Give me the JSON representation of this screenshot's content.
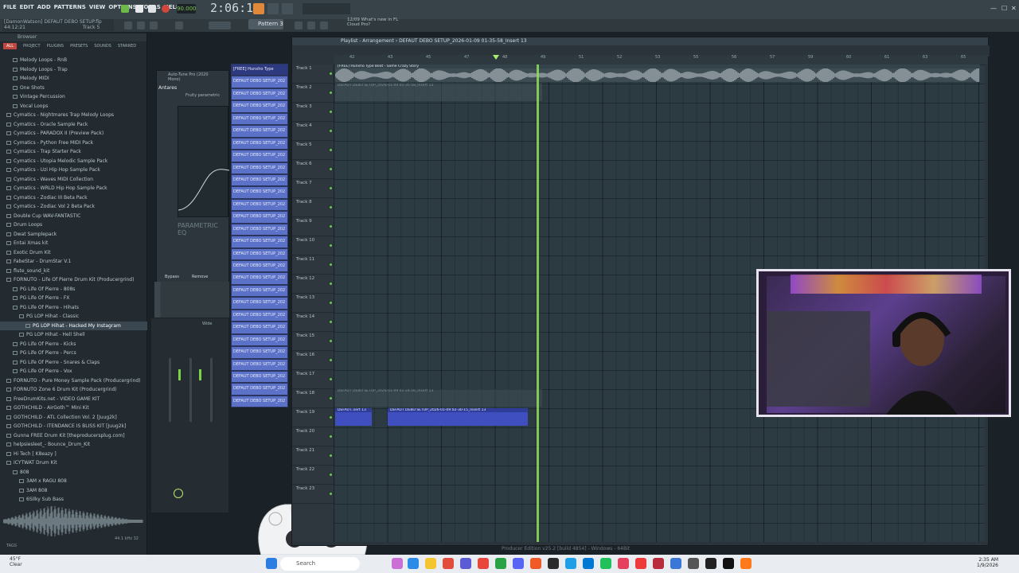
{
  "menu": [
    "FILE",
    "EDIT",
    "ADD",
    "PATTERNS",
    "VIEW",
    "OPTIONS",
    "TOOLS",
    "HELP"
  ],
  "project": {
    "user": "[DamonWatson]",
    "name": "DEFAUT DEBO SETUP.flp",
    "time": "44:12:21",
    "track": "Track 5"
  },
  "tempo": "90.000",
  "time_display": "2:06:16",
  "pattern": "Pattern 3",
  "news": {
    "line1": "12/09  What's new in FL",
    "line2": "Cloud Pro?"
  },
  "browser": {
    "title": "Browser",
    "tabs": [
      "ALL",
      "PROJECT",
      "PLUGINS",
      "PRESETS",
      "SOUNDS",
      "STARRED"
    ],
    "items": [
      {
        "label": "Melody Loops - RnB",
        "sel": false
      },
      {
        "label": "Melody Loops - Trap",
        "sel": false
      },
      {
        "label": "Melody MIDI",
        "sel": false
      },
      {
        "label": "One Shots",
        "sel": false
      },
      {
        "label": "Vintage Percussion",
        "sel": false
      },
      {
        "label": "Vocal Loops",
        "sel": false
      },
      {
        "label": "Cymatics - Nightmares Trap Melody Loops",
        "sel": false
      },
      {
        "label": "Cymatics - Oracle Sample Pack",
        "sel": false
      },
      {
        "label": "Cymatics - PARADOX II (Preview Pack)",
        "sel": false
      },
      {
        "label": "Cymatics - Python Free MIDI Pack",
        "sel": false
      },
      {
        "label": "Cymatics - Trap Starter Pack",
        "sel": false
      },
      {
        "label": "Cymatics - Utopia Melodic Sample Pack",
        "sel": false
      },
      {
        "label": "Cymatics - Uzi Hip Hop Sample Pack",
        "sel": false
      },
      {
        "label": "Cymatics - Waves MIDI Collection",
        "sel": false
      },
      {
        "label": "Cymatics - WRLD Hip Hop Sample Pack",
        "sel": false
      },
      {
        "label": "Cymatics - Zodiac III Beta Pack",
        "sel": false
      },
      {
        "label": "Cymatics - Zodiac Vol 2 Beta Pack",
        "sel": false
      },
      {
        "label": "Double Cup WAV-FANTASTIC",
        "sel": false
      },
      {
        "label": "Drum Loops",
        "sel": false
      },
      {
        "label": "Dwat Samplepack",
        "sel": false
      },
      {
        "label": "Entai Xmas kit",
        "sel": false
      },
      {
        "label": "Exotic Drum Kit",
        "sel": false
      },
      {
        "label": "FabeStar - DrumStar V.1",
        "sel": false
      },
      {
        "label": "flute_sound_kit",
        "sel": false
      },
      {
        "label": "FORNUTO - Life Of Pierre Drum Kit (Producergrind)",
        "sel": false
      },
      {
        "label": "PG Life Of Pierre - 808s",
        "sel": false
      },
      {
        "label": "PG Life Of Pierre - FX",
        "sel": false
      },
      {
        "label": "PG Life Of Pierre - Hihats",
        "sel": false
      },
      {
        "label": "PG LOP Hihat - Classic",
        "sel": false
      },
      {
        "label": "PG LOP Hihat - Hacked My Instagram",
        "sel": true
      },
      {
        "label": "PG LOP Hihat - Hell Shell",
        "sel": false
      },
      {
        "label": "PG Life Of Pierre - Kicks",
        "sel": false
      },
      {
        "label": "PG Life Of Pierre - Percs",
        "sel": false
      },
      {
        "label": "PG Life Of Pierre - Snares & Claps",
        "sel": false
      },
      {
        "label": "PG Life Of Pierre - Vox",
        "sel": false
      },
      {
        "label": "FORNUTO - Pure Money Sample Pack (Producergrind)",
        "sel": false
      },
      {
        "label": "FORNUTO Zone 6 Drum Kit (Producergrind)",
        "sel": false
      },
      {
        "label": "FreeDrumKits.net - VIDEO GAME KIT",
        "sel": false
      },
      {
        "label": "GOTHCHILD - AirGoth™ Mini Kit",
        "sel": false
      },
      {
        "label": "GOTHCHILD - ATL Collection Vol. 2 [Juug2k]",
        "sel": false
      },
      {
        "label": "GOTHCHILD - ITENDANCE IS BLISS KIT [Juug2k]",
        "sel": false
      },
      {
        "label": "Gunna FREE Drum Kit [theproducersplug.com]",
        "sel": false
      },
      {
        "label": "helpsiesleet_- Bounce_Drum_Kit",
        "sel": false
      },
      {
        "label": "Hi Tech [ K8eazy ]",
        "sel": false
      },
      {
        "label": "ICYTWAT Drum Kit",
        "sel": false
      },
      {
        "label": "808",
        "sel": false
      },
      {
        "label": "3AM x RAGU 808",
        "sel": false
      },
      {
        "label": "3AM 808",
        "sel": false
      },
      {
        "label": "6Silky Sub Bass",
        "sel": false
      }
    ],
    "tags_label": "TAGS",
    "preview_info": "44.1 kHz 32"
  },
  "plugin": {
    "title": "Auto-Tune Pro (2020 Mono)",
    "brand": "Antares",
    "sub": "Fruity parametric",
    "eq_label": "PARAMETRIC EQ",
    "remove_label": "Remove",
    "bypass_label": "Bypass",
    "mixer_label": "Wide"
  },
  "channels": [
    "[FREE] Hunxho Type",
    "DEFAUT DEBO SETUP_202",
    "DEFAUT DEBO SETUP_202",
    "DEFAUT DEBO SETUP_202",
    "DEFAUT DEBO SETUP_202",
    "DEFAUT DEBO SETUP_202",
    "DEFAUT DEBO SETUP_202",
    "DEFAUT DEBO SETUP_202",
    "DEFAUT DEBO SETUP_202",
    "DEFAUT DEBO SETUP_202",
    "DEFAUT DEBO SETUP_202",
    "DEFAUT DEBO SETUP_202",
    "DEFAUT DEBO SETUP_202",
    "DEFAUT DEBO SETUP_202",
    "DEFAUT DEBO SETUP_202",
    "DEFAUT DEBO SETUP_202",
    "DEFAUT DEBO SETUP_202",
    "DEFAUT DEBO SETUP_202",
    "DEFAUT DEBO SETUP_202",
    "DEFAUT DEBO SETUP_202",
    "DEFAUT DEBO SETUP_202",
    "DEFAUT DEBO SETUP_202",
    "DEFAUT DEBO SETUP_202",
    "DEFAUT DEBO SETUP_202",
    "DEFAUT DEBO SETUP_202",
    "DEFAUT DEBO SETUP_202",
    "DEFAUT DEBO SETUP_202",
    "DEFAUT DEBO SETUP_202"
  ],
  "playlist": {
    "title": "Playlist - Arrangement  ›  DEFAUT DEBO SETUP_2026-01-09 01-35-58_Insert 13",
    "ruler": [
      "42",
      "43",
      "45",
      "47",
      "48",
      "49",
      "51",
      "52",
      "53",
      "55",
      "56",
      "57",
      "59",
      "60",
      "61",
      "63",
      "65"
    ],
    "tracks": [
      "Track 1",
      "Track 2",
      "Track 3",
      "Track 4",
      "Track 5",
      "Track 6",
      "Track 7",
      "Track 8",
      "Track 9",
      "Track 10",
      "Track 11",
      "Track 12",
      "Track 13",
      "Track 14",
      "Track 15",
      "Track 16",
      "Track 17",
      "Track 18",
      "Track 19",
      "Track 20",
      "Track 21",
      "Track 22",
      "Track 23"
    ],
    "clips": {
      "beat": "[FREE] Hunxho Type Beat - Some Crazy Story",
      "ghost1": "DEFAUT DEBO SETUP_2026-01-09 01-35-58_Insert 13",
      "ghost18": "DEFAUT DEBO SETUP_2026-01-09 02-24-56_Insert 13",
      "clip19a": "DEFAUT..sert 13",
      "clip19b": "DEFAUT DEBO SETUP_2026-01-09 02-30-15_Insert 13"
    }
  },
  "status_bar": "Producer Edition v25.2 [build 4854] - Windows - 64Bit",
  "taskbar": {
    "weather_temp": "45°F",
    "weather_desc": "Clear",
    "search": "Search",
    "time": "2:35 AM",
    "date": "1/9/2026"
  },
  "colors": {
    "channel": "#5c72c9",
    "playhead": "#8fe05a",
    "clip_blue": "#3f4fbf",
    "accent": "#c0473f"
  }
}
